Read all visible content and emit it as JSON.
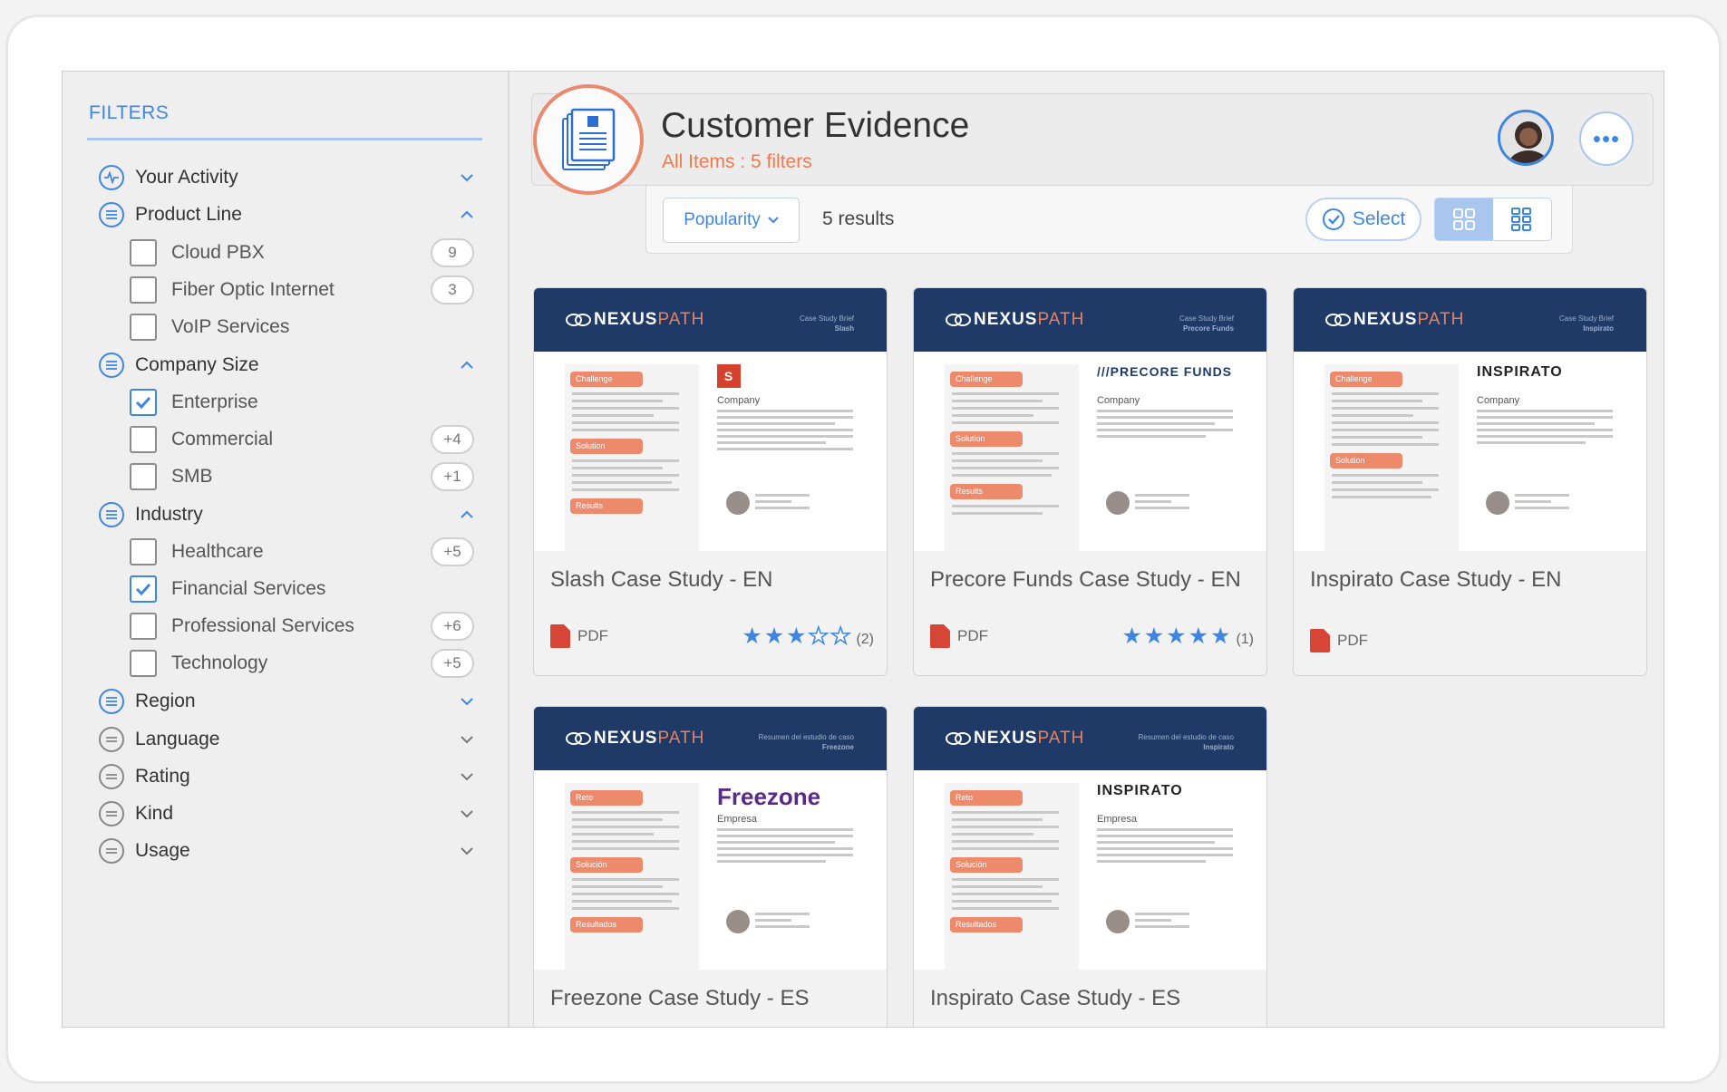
{
  "sidebar": {
    "title": "FILTERS",
    "groups": {
      "activity": {
        "label": "Your Activity"
      },
      "product_line": {
        "label": "Product Line",
        "items": [
          {
            "label": "Cloud PBX",
            "count": "9"
          },
          {
            "label": "Fiber Optic Internet",
            "count": "3"
          },
          {
            "label": "VoIP Services",
            "count": ""
          }
        ]
      },
      "company_size": {
        "label": "Company Size",
        "items": [
          {
            "label": "Enterprise",
            "count": "",
            "checked": true
          },
          {
            "label": "Commercial",
            "count": "+4"
          },
          {
            "label": "SMB",
            "count": "+1"
          }
        ]
      },
      "industry": {
        "label": "Industry",
        "items": [
          {
            "label": "Healthcare",
            "count": "+5"
          },
          {
            "label": "Financial Services",
            "count": "",
            "checked": true
          },
          {
            "label": "Professional Services",
            "count": "+6"
          },
          {
            "label": "Technology",
            "count": "+5"
          }
        ]
      },
      "region": {
        "label": "Region"
      },
      "language": {
        "label": "Language"
      },
      "rating": {
        "label": "Rating"
      },
      "kind": {
        "label": "Kind"
      },
      "usage": {
        "label": "Usage"
      }
    }
  },
  "header": {
    "title": "Customer Evidence",
    "subtitle": "All Items : 5 filters",
    "more_label": "•••"
  },
  "toolbar": {
    "sort_label": "Popularity",
    "results_count": "5",
    "results_label": "results",
    "select_label": "Select"
  },
  "colors": {
    "accent": "#3f86e2",
    "orange": "#ee7a50",
    "navy": "#1f3a66",
    "pdf": "#d64535"
  },
  "cards": [
    {
      "title": "Slash Case Study - EN",
      "kind": "PDF",
      "rating": 3,
      "rating_count": "(2)",
      "brand_word": "NEXUS",
      "brand_word2": "PATH",
      "brief": "Case Study Brief",
      "client": "Slash",
      "company_label": "Company",
      "pills": [
        "Challenge",
        "Solution",
        "Results"
      ],
      "logo": "S"
    },
    {
      "title": "Precore Funds Case Study - EN",
      "kind": "PDF",
      "rating": 5,
      "rating_count": "(1)",
      "brand_word": "NEXUS",
      "brand_word2": "PATH",
      "brief": "Case Study Brief",
      "client": "Precore Funds",
      "company_label": "Company",
      "pills": [
        "Challenge",
        "Solution",
        "Results"
      ],
      "logo": "///PRECORE FUNDS"
    },
    {
      "title": "Inspirato Case Study - EN",
      "kind": "PDF",
      "rating": null,
      "rating_count": "",
      "brand_word": "NEXUS",
      "brand_word2": "PATH",
      "brief": "Case Study Brief",
      "client": "Inspirato",
      "company_label": "Company",
      "pills": [
        "Challenge",
        "Solution"
      ],
      "logo": "INSPIRATO"
    },
    {
      "title": "Freezone Case Study - ES",
      "brand_word": "NEXUS",
      "brand_word2": "PATH",
      "brief": "Resumen del estudio de caso",
      "client": "Freezone",
      "company_label": "Empresa",
      "pills": [
        "Reto",
        "Solución",
        "Resultados"
      ],
      "logo": "Freezone"
    },
    {
      "title": "Inspirato Case Study - ES",
      "brand_word": "NEXUS",
      "brand_word2": "PATH",
      "brief": "Resumen del estudio de caso",
      "client": "Inspirato",
      "company_label": "Empresa",
      "pills": [
        "Reto",
        "Solución",
        "Resultados"
      ],
      "logo": "INSPIRATO"
    }
  ]
}
